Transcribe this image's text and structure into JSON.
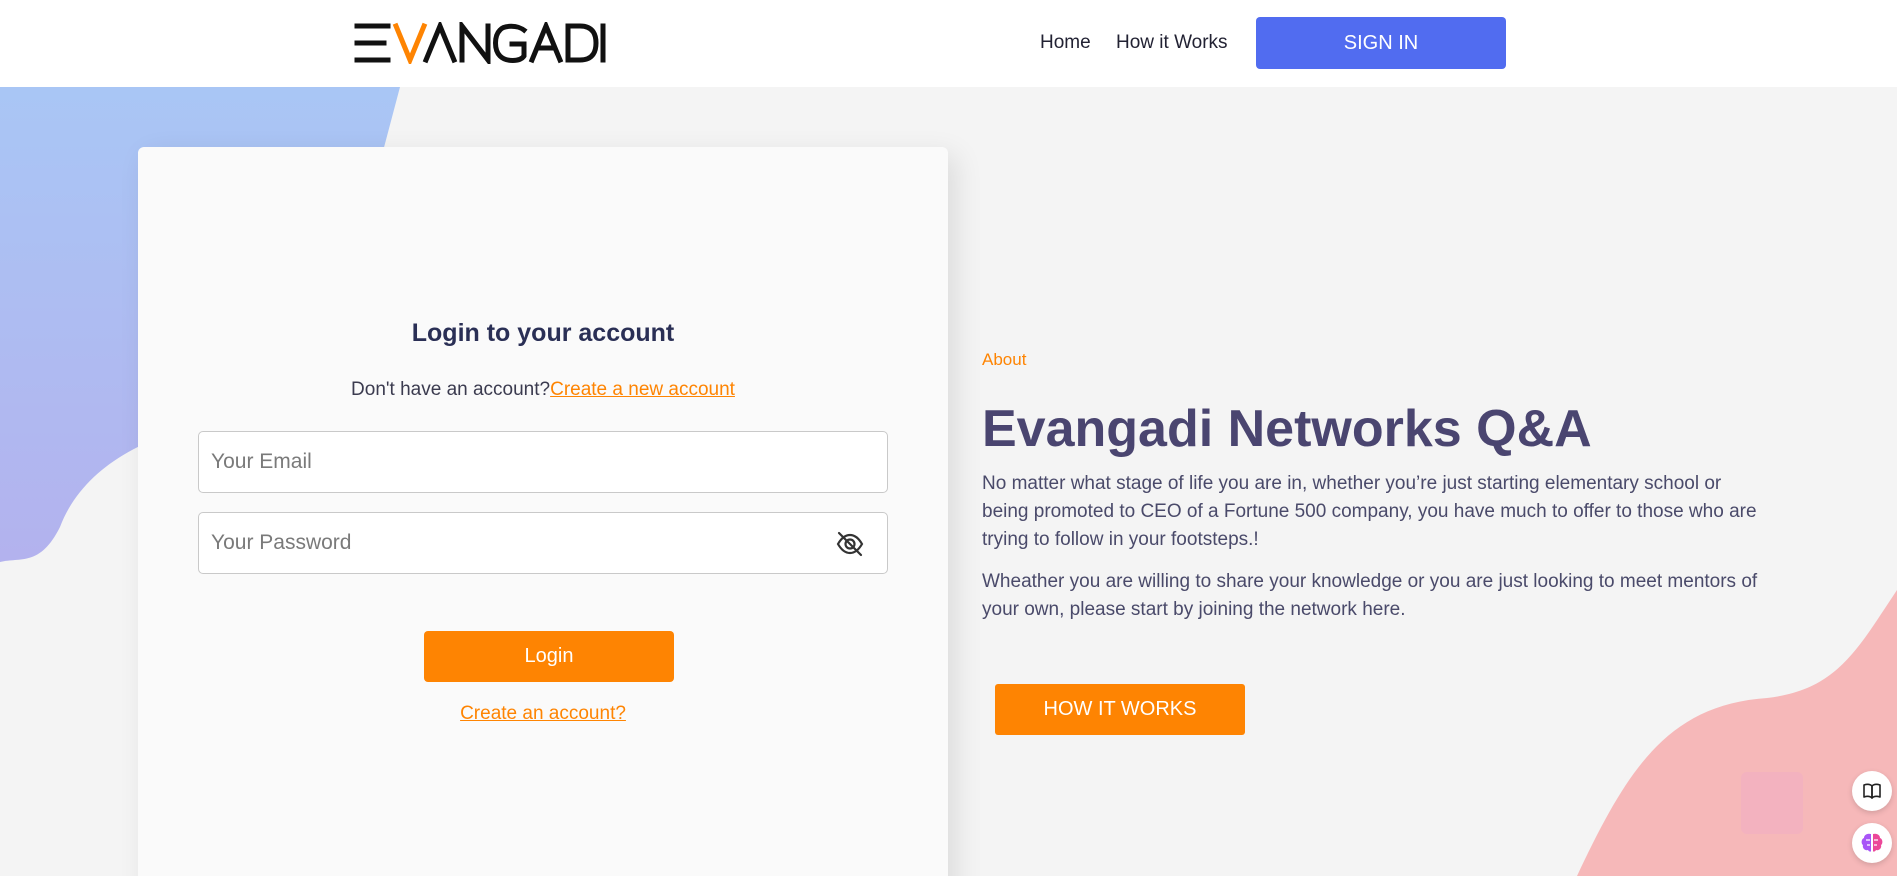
{
  "header": {
    "logo_text": "EVANGADI",
    "nav": {
      "home": "Home",
      "how_it_works": "How it Works"
    },
    "signin_label": "SIGN IN"
  },
  "login": {
    "title": "Login to your account",
    "no_account_text": "Don't have an account?",
    "create_new_link": "Create a new account",
    "email_placeholder": "Your Email",
    "password_placeholder": "Your Password",
    "login_label": "Login",
    "create_account_link": "Create an account?"
  },
  "about": {
    "tag": "About",
    "title": "Evangadi Networks Q&A",
    "paragraph1": "No matter what stage of life you are in, whether you’re just starting elementary school or being promoted to CEO of a Fortune 500 company, you have much to offer to those who are trying to follow in your footsteps.!",
    "paragraph2": "Wheather you are willing to share your knowledge or you are just looking to meet mentors of your own, please start by joining the network here.",
    "how_it_works_label": "HOW IT WORKS"
  },
  "colors": {
    "accent_orange": "#fe8402",
    "signin_blue": "#516cf0",
    "heading": "#4a4570"
  },
  "icons": {
    "password_toggle": "eye-off-icon",
    "book": "book-icon",
    "brain": "brain-icon"
  }
}
